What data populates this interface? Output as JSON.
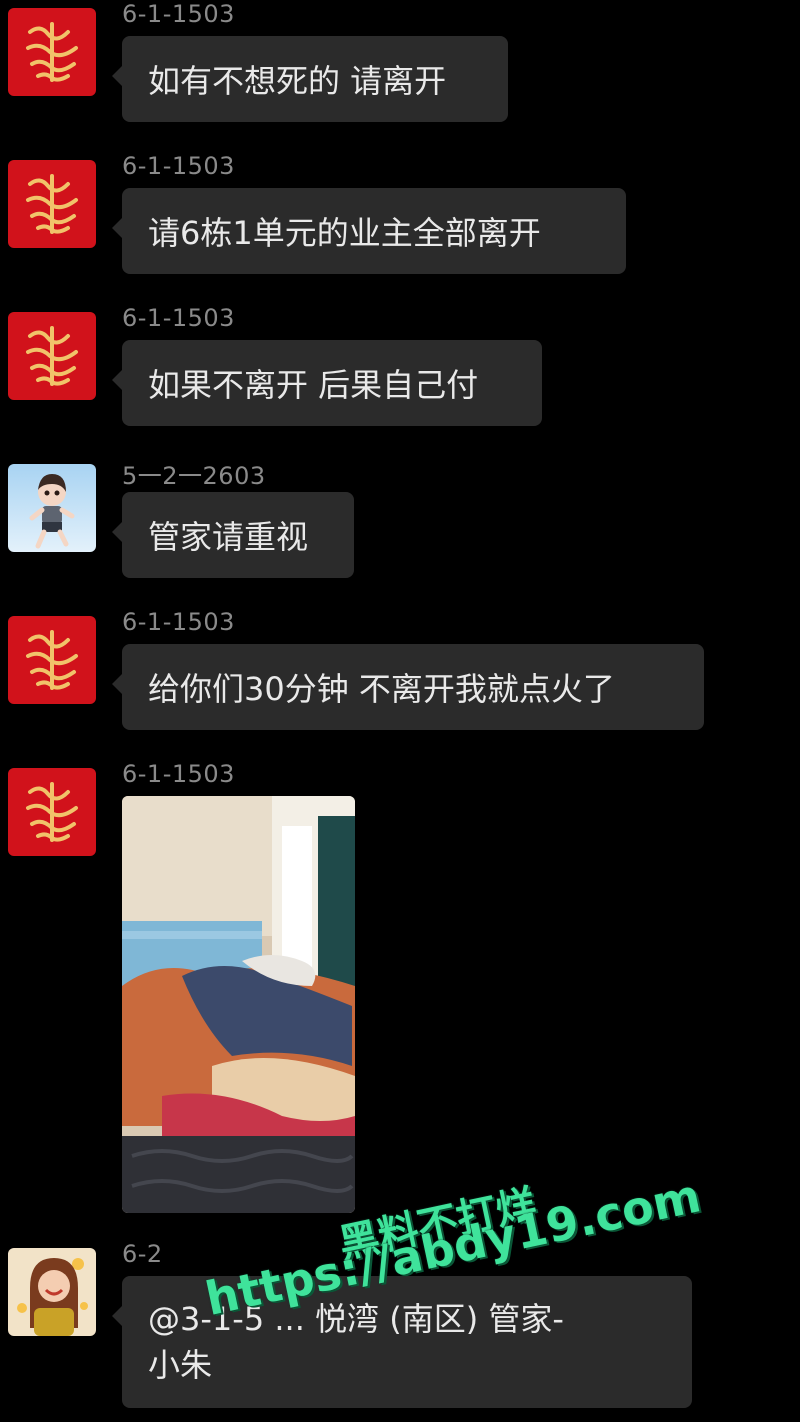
{
  "messages": [
    {
      "sender": "6-1-1503",
      "avatar": "red-fu-icon",
      "text": "如有不想死的 请离开"
    },
    {
      "sender": "6-1-1503",
      "avatar": "red-fu-icon",
      "text": "请6栋1单元的业主全部离开"
    },
    {
      "sender": "6-1-1503",
      "avatar": "red-fu-icon",
      "text": "如果不离开 后果自己付"
    },
    {
      "sender": "5一2一2603",
      "avatar": "cartoon-girl-avatar",
      "text": "管家请重视"
    },
    {
      "sender": "6-1-1503",
      "avatar": "red-fu-icon",
      "text": "给你们30分钟 不离开我就点火了"
    },
    {
      "sender": "6-1-1503",
      "avatar": "red-fu-icon",
      "image": "bedroom-photo"
    },
    {
      "sender": "6-2",
      "avatar": "smiling-woman-avatar",
      "text_line1": "@3-1-5 ... 悦湾 (南区) 管家-",
      "text_line2": "小朱"
    }
  ],
  "watermark": {
    "line1": "黑料不打烊",
    "line2": "https://abdy19.com"
  },
  "colors": {
    "background": "#000000",
    "bubble": "#2b2b2b",
    "sender_text": "#8a8a8a",
    "watermark": "#3fe39b",
    "avatar_red": "#d1121b"
  }
}
